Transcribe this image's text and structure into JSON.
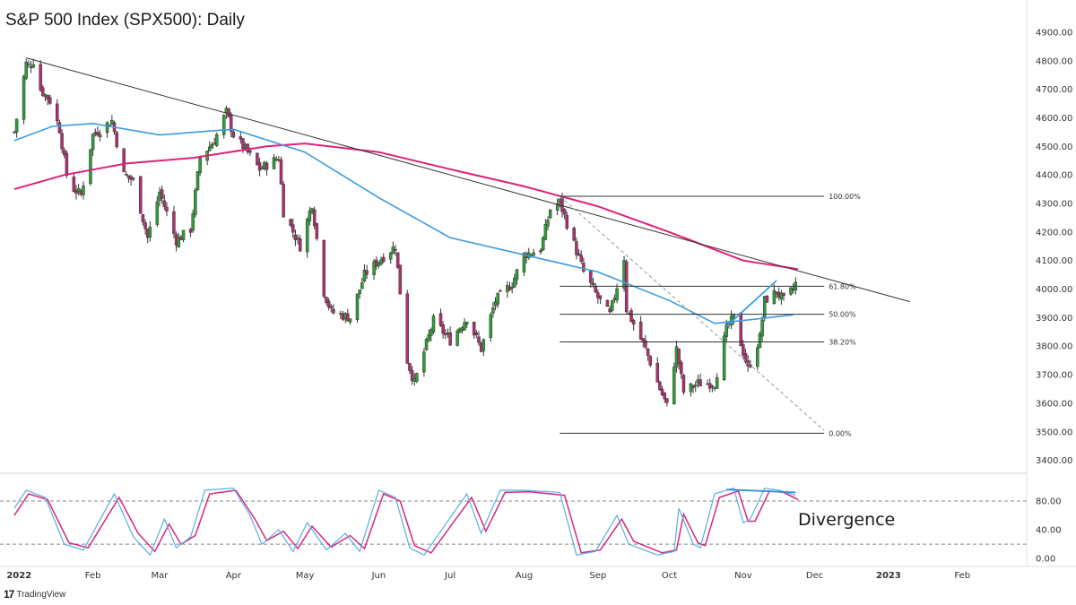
{
  "title": "S&P 500 Index (SPX500): Daily",
  "branding": "TradingView",
  "chart_data": [
    {
      "type": "candlestick",
      "title": "S&P 500 Index (SPX500): Daily",
      "ylim": [
        3380,
        4950
      ],
      "yticks": [
        "4900.00",
        "4800.00",
        "4700.00",
        "4600.00",
        "4500.00",
        "4400.00",
        "4300.00",
        "4200.00",
        "4100.00",
        "4000.00",
        "3900.00",
        "3800.00",
        "3700.00",
        "3600.00",
        "3500.00",
        "3400.00"
      ],
      "xticks": [
        "2022",
        "Feb",
        "Mar",
        "Apr",
        "May",
        "Jun",
        "Jul",
        "Aug",
        "Sep",
        "Oct",
        "Nov",
        "Dec",
        "2023",
        "Feb"
      ],
      "colors": {
        "up": "#2e9e35",
        "down": "#b0306e",
        "ma_slow": "#e0207a",
        "ma_fast": "#3d9be0",
        "trendline": "#333333",
        "fib": "#333333"
      },
      "close_path": [
        [
          "2021-12-30",
          4550
        ],
        [
          "2022-01-04",
          4790
        ],
        [
          "2022-01-05",
          4780
        ],
        [
          "2022-01-07",
          4800
        ],
        [
          "2022-01-10",
          4700
        ],
        [
          "2022-01-14",
          4660
        ],
        [
          "2022-01-18",
          4560
        ],
        [
          "2022-01-21",
          4400
        ],
        [
          "2022-01-24",
          4350
        ],
        [
          "2022-01-27",
          4330
        ],
        [
          "2022-02-01",
          4540
        ],
        [
          "2022-02-09",
          4590
        ],
        [
          "2022-02-14",
          4400
        ],
        [
          "2022-02-18",
          4380
        ],
        [
          "2022-02-24",
          4180
        ],
        [
          "2022-03-01",
          4340
        ],
        [
          "2022-03-08",
          4170
        ],
        [
          "2022-03-14",
          4210
        ],
        [
          "2022-03-18",
          4460
        ],
        [
          "2022-03-24",
          4520
        ],
        [
          "2022-03-29",
          4620
        ],
        [
          "2022-04-01",
          4540
        ],
        [
          "2022-04-06",
          4490
        ],
        [
          "2022-04-12",
          4420
        ],
        [
          "2022-04-20",
          4460
        ],
        [
          "2022-04-22",
          4270
        ],
        [
          "2022-04-29",
          4150
        ],
        [
          "2022-05-04",
          4300
        ],
        [
          "2022-05-09",
          3990
        ],
        [
          "2022-05-12",
          3920
        ],
        [
          "2022-05-20",
          3900
        ],
        [
          "2022-05-26",
          4050
        ],
        [
          "2022-06-01",
          4100
        ],
        [
          "2022-06-08",
          4150
        ],
        [
          "2022-06-13",
          3750
        ],
        [
          "2022-06-16",
          3670
        ],
        [
          "2022-06-24",
          3890
        ],
        [
          "2022-07-01",
          3820
        ],
        [
          "2022-07-08",
          3900
        ],
        [
          "2022-07-14",
          3790
        ],
        [
          "2022-07-20",
          3960
        ],
        [
          "2022-07-27",
          4020
        ],
        [
          "2022-08-01",
          4120
        ],
        [
          "2022-08-08",
          4140
        ],
        [
          "2022-08-12",
          4280
        ],
        [
          "2022-08-16",
          4305
        ],
        [
          "2022-08-19",
          4230
        ],
        [
          "2022-08-26",
          4060
        ],
        [
          "2022-09-01",
          3970
        ],
        [
          "2022-09-06",
          3910
        ],
        [
          "2022-09-12",
          4110
        ],
        [
          "2022-09-13",
          3930
        ],
        [
          "2022-09-21",
          3790
        ],
        [
          "2022-09-27",
          3650
        ],
        [
          "2022-09-30",
          3590
        ],
        [
          "2022-10-04",
          3790
        ],
        [
          "2022-10-07",
          3640
        ],
        [
          "2022-10-13",
          3670
        ],
        [
          "2022-10-20",
          3670
        ],
        [
          "2022-10-25",
          3860
        ],
        [
          "2022-10-28",
          3900
        ],
        [
          "2022-11-03",
          3720
        ],
        [
          "2022-11-08",
          3830
        ],
        [
          "2022-11-10",
          3960
        ],
        [
          "2022-11-15",
          3990
        ],
        [
          "2022-11-18",
          3960
        ],
        [
          "2022-11-22",
          4000
        ],
        [
          "2022-11-23",
          4020
        ]
      ],
      "ma_slow": [
        [
          "2021-12-30",
          4350
        ],
        [
          "2022-01-20",
          4400
        ],
        [
          "2022-02-15",
          4440
        ],
        [
          "2022-03-15",
          4460
        ],
        [
          "2022-04-15",
          4500
        ],
        [
          "2022-05-01",
          4510
        ],
        [
          "2022-06-01",
          4480
        ],
        [
          "2022-07-01",
          4420
        ],
        [
          "2022-08-01",
          4360
        ],
        [
          "2022-09-01",
          4290
        ],
        [
          "2022-10-01",
          4200
        ],
        [
          "2022-11-01",
          4100
        ],
        [
          "2022-11-24",
          4070
        ]
      ],
      "ma_fast": [
        [
          "2021-12-30",
          4520
        ],
        [
          "2022-01-15",
          4570
        ],
        [
          "2022-02-01",
          4580
        ],
        [
          "2022-03-01",
          4540
        ],
        [
          "2022-04-01",
          4560
        ],
        [
          "2022-05-01",
          4480
        ],
        [
          "2022-06-01",
          4320
        ],
        [
          "2022-07-01",
          4180
        ],
        [
          "2022-08-01",
          4120
        ],
        [
          "2022-09-01",
          4060
        ],
        [
          "2022-10-01",
          3960
        ],
        [
          "2022-10-20",
          3880
        ],
        [
          "2022-11-01",
          3890
        ],
        [
          "2022-11-22",
          3910
        ]
      ],
      "trendline": [
        [
          "2022-01-04",
          4810
        ],
        [
          "2023-01-10",
          3956
        ]
      ],
      "swing_line": [
        [
          "2022-08-16",
          4325
        ],
        [
          "2022-12-05",
          3505
        ]
      ],
      "price_trend": [
        [
          "2022-10-25",
          3870
        ],
        [
          "2022-11-15",
          4030
        ]
      ],
      "fib_range": [
        "2022-08-16",
        "2022-12-05"
      ],
      "fib_levels": [
        {
          "label": "100.00%",
          "value": 4325
        },
        {
          "label": "61.80%",
          "value": 4010
        },
        {
          "label": "50.00%",
          "value": 3912
        },
        {
          "label": "38.20%",
          "value": 3815
        },
        {
          "label": "0.00%",
          "value": 3495
        }
      ]
    },
    {
      "type": "line",
      "yticks": [
        "80.00",
        "40.00",
        "0.00"
      ],
      "ylim": [
        -6,
        110
      ],
      "levels": [
        80,
        20
      ],
      "k": [
        [
          "2021-12-30",
          70
        ],
        [
          "2022-01-04",
          95
        ],
        [
          "2022-01-12",
          85
        ],
        [
          "2022-01-20",
          20
        ],
        [
          "2022-01-28",
          12
        ],
        [
          "2022-02-10",
          90
        ],
        [
          "2022-02-18",
          30
        ],
        [
          "2022-02-25",
          5
        ],
        [
          "2022-03-03",
          55
        ],
        [
          "2022-03-08",
          15
        ],
        [
          "2022-03-14",
          30
        ],
        [
          "2022-03-20",
          95
        ],
        [
          "2022-04-01",
          98
        ],
        [
          "2022-04-08",
          60
        ],
        [
          "2022-04-13",
          20
        ],
        [
          "2022-04-20",
          40
        ],
        [
          "2022-04-26",
          10
        ],
        [
          "2022-05-02",
          50
        ],
        [
          "2022-05-10",
          12
        ],
        [
          "2022-05-18",
          35
        ],
        [
          "2022-05-24",
          10
        ],
        [
          "2022-06-01",
          95
        ],
        [
          "2022-06-08",
          85
        ],
        [
          "2022-06-14",
          15
        ],
        [
          "2022-06-20",
          5
        ],
        [
          "2022-07-08",
          90
        ],
        [
          "2022-07-14",
          35
        ],
        [
          "2022-07-22",
          95
        ],
        [
          "2022-08-01",
          95
        ],
        [
          "2022-08-16",
          92
        ],
        [
          "2022-08-23",
          5
        ],
        [
          "2022-08-31",
          10
        ],
        [
          "2022-09-09",
          60
        ],
        [
          "2022-09-14",
          20
        ],
        [
          "2022-09-26",
          5
        ],
        [
          "2022-10-03",
          10
        ],
        [
          "2022-10-05",
          70
        ],
        [
          "2022-10-11",
          20
        ],
        [
          "2022-10-14",
          15
        ],
        [
          "2022-10-20",
          90
        ],
        [
          "2022-10-28",
          98
        ],
        [
          "2022-11-01",
          50
        ],
        [
          "2022-11-04",
          55
        ],
        [
          "2022-11-10",
          98
        ],
        [
          "2022-11-16",
          95
        ],
        [
          "2022-11-23",
          88
        ]
      ],
      "d": [
        [
          "2021-12-30",
          60
        ],
        [
          "2022-01-05",
          90
        ],
        [
          "2022-01-13",
          82
        ],
        [
          "2022-01-22",
          22
        ],
        [
          "2022-01-30",
          15
        ],
        [
          "2022-02-12",
          85
        ],
        [
          "2022-02-20",
          35
        ],
        [
          "2022-02-27",
          10
        ],
        [
          "2022-03-05",
          48
        ],
        [
          "2022-03-10",
          20
        ],
        [
          "2022-03-16",
          32
        ],
        [
          "2022-03-22",
          90
        ],
        [
          "2022-04-02",
          95
        ],
        [
          "2022-04-10",
          55
        ],
        [
          "2022-04-15",
          25
        ],
        [
          "2022-04-22",
          38
        ],
        [
          "2022-04-28",
          14
        ],
        [
          "2022-05-04",
          45
        ],
        [
          "2022-05-12",
          16
        ],
        [
          "2022-05-20",
          32
        ],
        [
          "2022-05-26",
          14
        ],
        [
          "2022-06-03",
          90
        ],
        [
          "2022-06-10",
          80
        ],
        [
          "2022-06-16",
          18
        ],
        [
          "2022-06-23",
          8
        ],
        [
          "2022-07-10",
          85
        ],
        [
          "2022-07-16",
          38
        ],
        [
          "2022-07-24",
          92
        ],
        [
          "2022-08-03",
          93
        ],
        [
          "2022-08-18",
          88
        ],
        [
          "2022-08-25",
          8
        ],
        [
          "2022-09-02",
          12
        ],
        [
          "2022-09-11",
          55
        ],
        [
          "2022-09-16",
          24
        ],
        [
          "2022-09-28",
          8
        ],
        [
          "2022-10-04",
          12
        ],
        [
          "2022-10-07",
          62
        ],
        [
          "2022-10-13",
          22
        ],
        [
          "2022-10-16",
          18
        ],
        [
          "2022-10-22",
          85
        ],
        [
          "2022-10-30",
          94
        ],
        [
          "2022-11-03",
          52
        ],
        [
          "2022-11-06",
          52
        ],
        [
          "2022-11-12",
          94
        ],
        [
          "2022-11-18",
          92
        ],
        [
          "2022-11-24",
          82
        ]
      ],
      "divergence_line": [
        [
          "2022-10-25",
          96
        ],
        [
          "2022-11-23",
          92
        ]
      ],
      "annotation": "Divergence",
      "colors": {
        "k": "#5aaee8",
        "d": "#d6287c",
        "divergence": "#2f8fdc"
      }
    }
  ]
}
